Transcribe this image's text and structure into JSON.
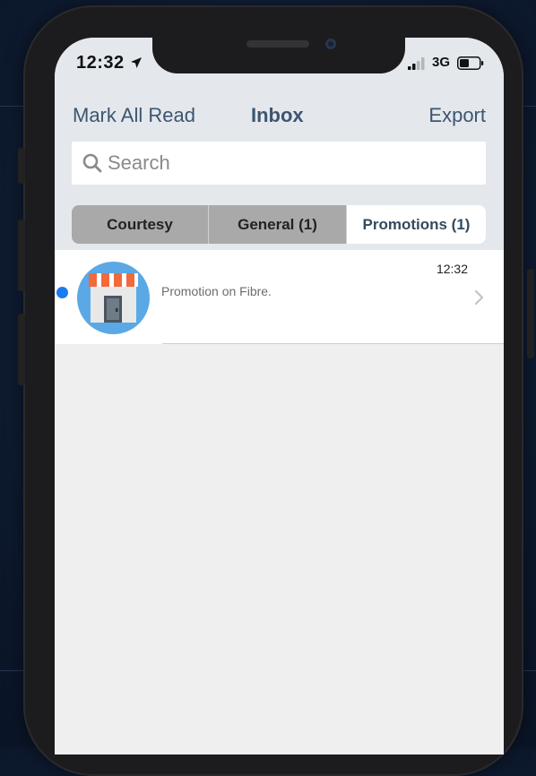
{
  "status_bar": {
    "time": "12:32",
    "network": "3G",
    "icons": [
      "location-arrow-icon",
      "signal-icon",
      "battery-icon"
    ]
  },
  "header": {
    "mark_all_read": "Mark All Read",
    "title": "Inbox",
    "export": "Export"
  },
  "search": {
    "placeholder": "Search",
    "value": ""
  },
  "tabs": [
    {
      "label": "Courtesy",
      "selected": false
    },
    {
      "label": "General (1)",
      "selected": false
    },
    {
      "label": "Promotions (1)",
      "selected": true
    }
  ],
  "messages": [
    {
      "text": "Promotion on Fibre.",
      "time": "12:32",
      "unread": true,
      "icon": "storefront-icon"
    }
  ],
  "colors": {
    "header_bg": "#e4e8ed",
    "accent_text": "#3d5570",
    "unread_dot": "#1a7cf0",
    "tab_inactive": "#a9a9a9",
    "tab_active": "#ffffff",
    "avatar_bg": "#5aa9e6",
    "awning_red": "#f06a3c"
  }
}
